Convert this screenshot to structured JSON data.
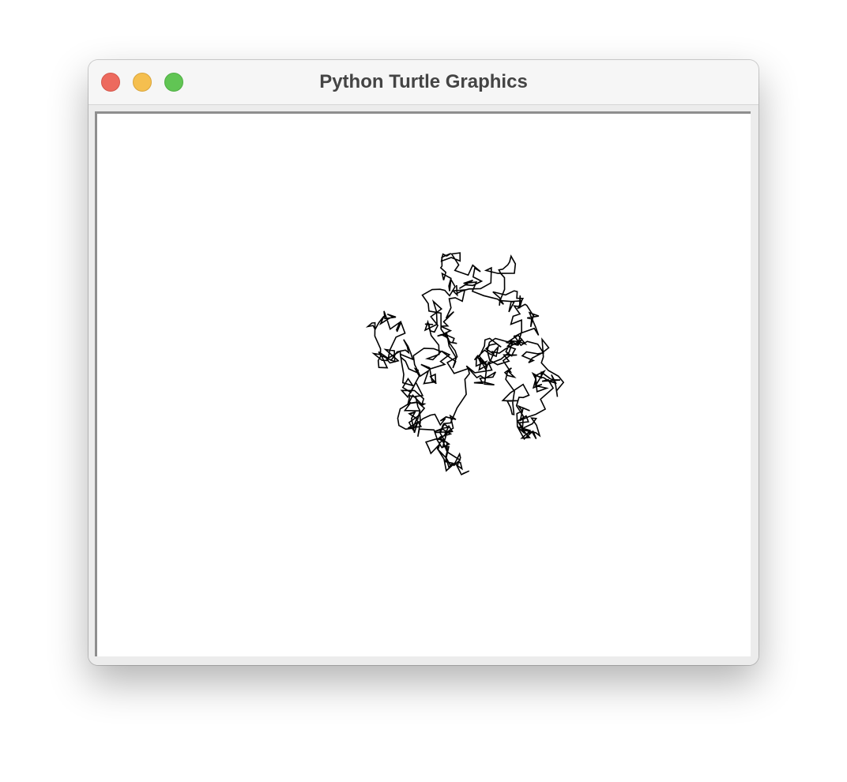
{
  "window": {
    "title": "Python Turtle Graphics"
  },
  "controls": {
    "close_icon": "close-icon",
    "minimize_icon": "minimize-icon",
    "zoom_icon": "zoom-icon"
  },
  "canvas": {
    "background": "#ffffff",
    "pen_color": "#000000",
    "drawing": "random-walk"
  }
}
